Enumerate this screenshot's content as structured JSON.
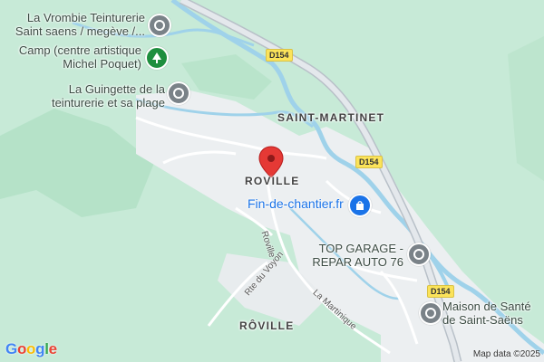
{
  "pois": {
    "vrombie": {
      "line1": "La Vrombie Teinturerie",
      "line2": "Saint saens / megève /..."
    },
    "camp": {
      "line1": "Camp (centre artistique",
      "line2": "Michel Poquet)"
    },
    "guinguette": {
      "line1": "La Guingette de la",
      "line2": "teinturerie et sa plage"
    },
    "fin_de_chantier": {
      "line1": "Fin-de-chantier.fr"
    },
    "top_garage": {
      "line1": "TOP GARAGE -",
      "line2": "REPAR AUTO 76"
    },
    "maison_sante": {
      "line1": "Maison de Santé",
      "line2": "de Saint-Saëns"
    }
  },
  "places": {
    "saint_martinet": "SAINT-MARTINET",
    "roville": "ROVILLE",
    "roville_accent": "RÔVILLE"
  },
  "roads": {
    "d154_a": "D154",
    "d154_b": "D154",
    "d154_c": "D154",
    "roville_road": "Roville",
    "rte_du_voyon": "Rte du Voyon",
    "la_martinique": "La Martinique"
  },
  "attribution": "Map data ©2025",
  "logo_letters": [
    "G",
    "o",
    "o",
    "g",
    "l",
    "e"
  ],
  "colors": {
    "forest": "#c7ead7",
    "dark_forest": "#a8dcbf",
    "urban": "#eceff1",
    "water": "#9fd2ea",
    "road": "#ffffff",
    "highway": "#b8c0c8",
    "pin_red": "#e53935"
  }
}
